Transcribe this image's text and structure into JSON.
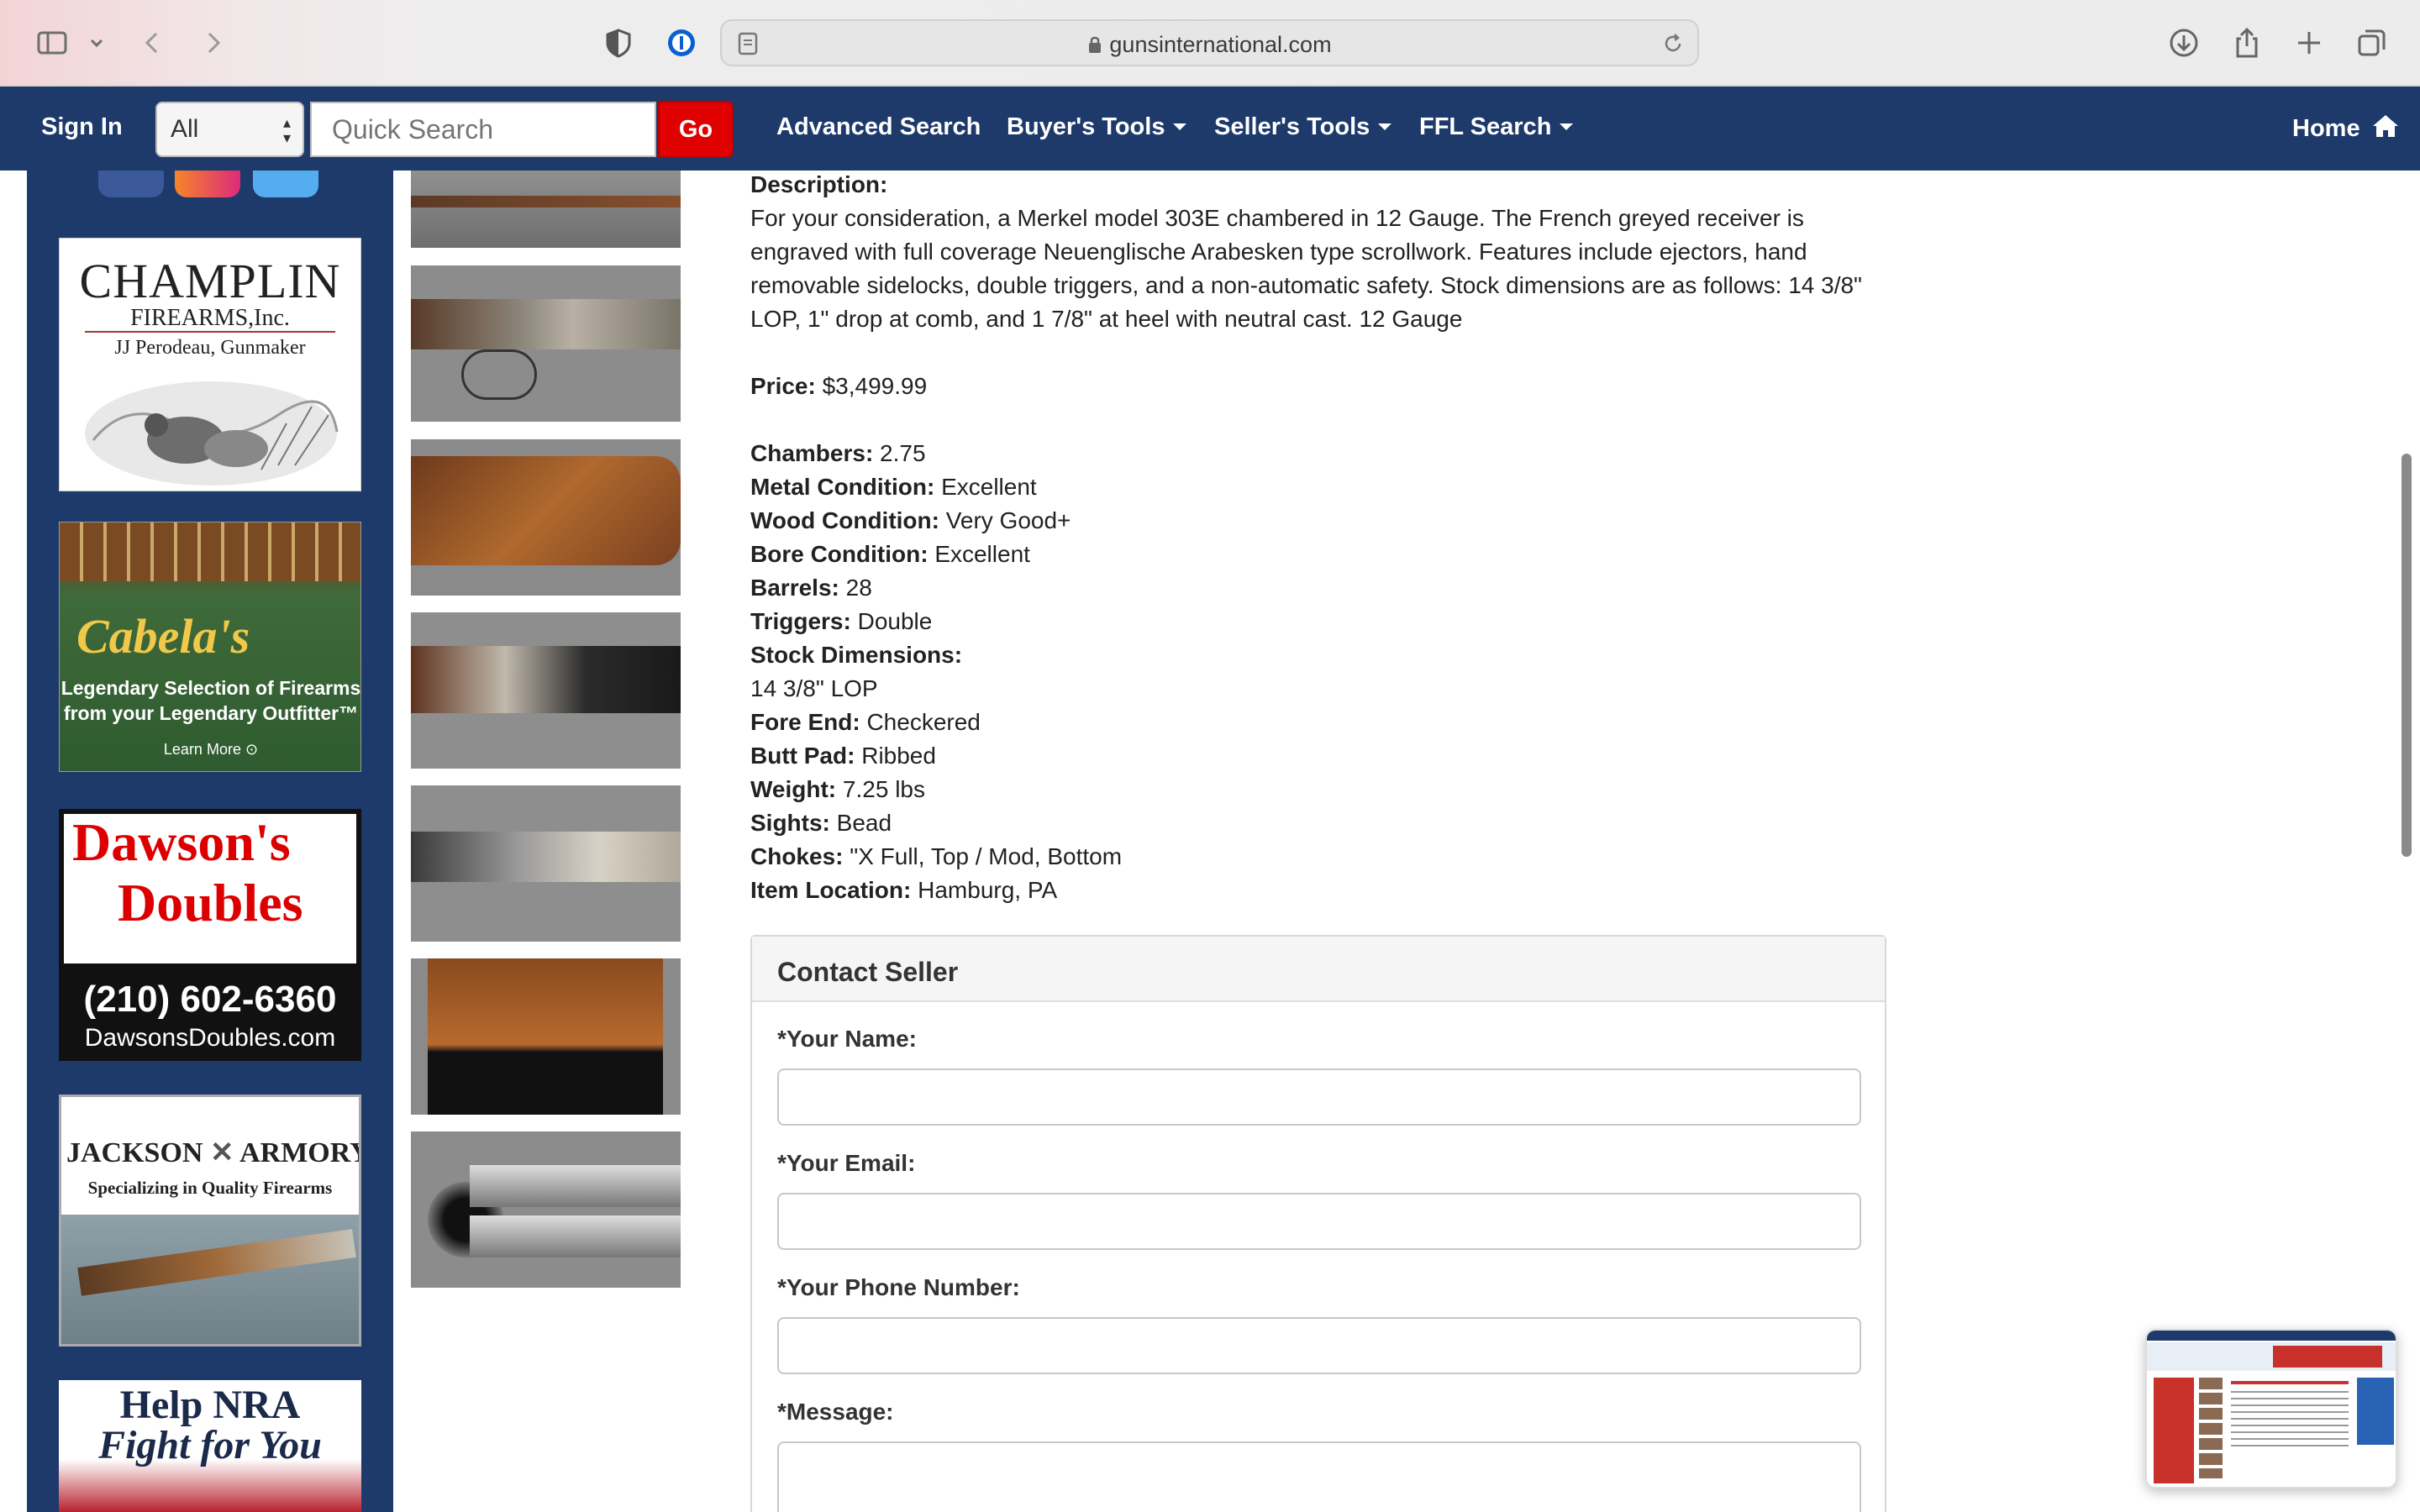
{
  "browser": {
    "url": "gunsinternational.com"
  },
  "nav": {
    "sign_in": "Sign In",
    "category_select": "All",
    "search_placeholder": "Quick Search",
    "go": "Go",
    "advanced_search": "Advanced Search",
    "buyers_tools": "Buyer's Tools",
    "sellers_tools": "Seller's Tools",
    "ffl_search": "FFL Search",
    "home": "Home"
  },
  "sidebar_ads": {
    "champlin": {
      "line1": "CHAMPLIN",
      "line2": "FIREARMS,Inc.",
      "line3": "JJ Perodeau, Gunmaker"
    },
    "cabelas": {
      "brand": "Cabela's",
      "line1": "Legendary Selection of Firearms",
      "line2": "from your Legendary Outfitter™",
      "cta": "Learn More"
    },
    "dawsons": {
      "line1": "Dawson's",
      "line2": "Doubles",
      "phone": "(210) 602-6360",
      "site": "DawsonsDoubles.com"
    },
    "jackson": {
      "brand_left": "JACKSON",
      "brand_right": "ARMORY",
      "tagline": "Specializing in Quality Firearms"
    },
    "nra": {
      "line1": "Help NRA",
      "line2": "Fight for You"
    }
  },
  "listing": {
    "description_label": "Description:",
    "description": "For your consideration, a Merkel model 303E chambered in 12 Gauge. The French greyed receiver is engraved with full coverage Neuenglische Arabesken type scrollwork. Features include ejectors, hand removable sidelocks, double triggers, and a non-automatic safety. Stock dimensions are as follows: 14 3/8\" LOP, 1\" drop at comb, and 1 7/8\" at heel with neutral cast. 12 Gauge",
    "price_label": "Price:",
    "price": "$3,499.99",
    "specs": [
      {
        "label": "Chambers:",
        "value": "2.75"
      },
      {
        "label": "Metal Condition:",
        "value": "Excellent"
      },
      {
        "label": "Wood Condition:",
        "value": "Very Good+"
      },
      {
        "label": "Bore Condition:",
        "value": "Excellent"
      },
      {
        "label": "Barrels:",
        "value": "28"
      },
      {
        "label": "Triggers:",
        "value": "Double"
      },
      {
        "label": "Stock Dimensions:",
        "value": ""
      },
      {
        "label": "",
        "value": "14 3/8\" LOP"
      },
      {
        "label": "Fore End:",
        "value": "Checkered"
      },
      {
        "label": "Butt Pad:",
        "value": "Ribbed"
      },
      {
        "label": "Weight:",
        "value": "7.25 lbs"
      },
      {
        "label": "Sights:",
        "value": "Bead"
      },
      {
        "label": "Chokes:",
        "value": "\"X Full, Top / Mod, Bottom"
      },
      {
        "label": "Item Location:",
        "value": "Hamburg, PA"
      }
    ]
  },
  "contact": {
    "title": "Contact Seller",
    "name_label": "*Your Name:",
    "email_label": "*Your Email:",
    "phone_label": "*Your Phone Number:",
    "message_label": "*Message:"
  }
}
